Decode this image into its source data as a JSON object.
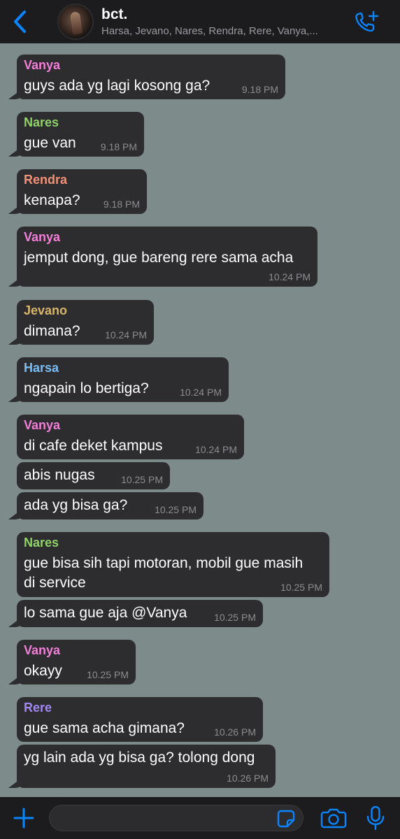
{
  "header": {
    "group_name": "bct.",
    "members": "Harsa, Jevano, Nares, Rendra, Rere, Vanya,...",
    "back_icon": "chevron-left-icon",
    "call_icon": "phone-plus-icon"
  },
  "colors": {
    "accent": "#0a84ff",
    "chat_background": "#7e8b8b",
    "bubble": "#2d2c2f",
    "sender_vanya": "#f27fd9",
    "sender_nares": "#8fd36a",
    "sender_rendra": "#f49179",
    "sender_jevano": "#d9b66a",
    "sender_harsa": "#78bdf5",
    "sender_rere": "#a387f2"
  },
  "messages": [
    {
      "sender": "Vanya",
      "text": "guys ada yg lagi kosong ga?",
      "time": "9.18 PM"
    },
    {
      "sender": "Nares",
      "text": "gue van",
      "time": "9.18 PM"
    },
    {
      "sender": "Rendra",
      "text": "kenapa?",
      "time": "9.18 PM"
    },
    {
      "sender": "Vanya",
      "text": "jemput dong, gue bareng rere sama acha",
      "time": "10.24 PM"
    },
    {
      "sender": "Jevano",
      "text": "dimana?",
      "time": "10.24 PM"
    },
    {
      "sender": "Harsa",
      "text": "ngapain lo bertiga?",
      "time": "10.24 PM"
    },
    {
      "sender": "Vanya",
      "text": "di cafe deket kampus",
      "time": "10.24 PM"
    },
    {
      "sender": "",
      "text": "abis nugas",
      "time": "10.25 PM"
    },
    {
      "sender": "",
      "text": "ada yg bisa ga?",
      "time": "10.25 PM"
    },
    {
      "sender": "Nares",
      "text_line1": "gue bisa sih tapi motoran, mobil gue masih",
      "text_line2": "di service",
      "time": "10.25 PM"
    },
    {
      "sender": "",
      "text": "lo sama gue aja @Vanya",
      "time": "10.25 PM"
    },
    {
      "sender": "Vanya",
      "text": "okayy",
      "time": "10.25 PM"
    },
    {
      "sender": "Rere",
      "text": "gue sama acha gimana?",
      "time": "10.26 PM"
    },
    {
      "sender": "",
      "text": "yg lain ada yg bisa ga? tolong dong",
      "time": "10.26 PM"
    }
  ],
  "composer": {
    "value": "",
    "placeholder": "",
    "icons": [
      "plus-icon",
      "sticker-icon",
      "camera-icon",
      "microphone-icon"
    ]
  }
}
